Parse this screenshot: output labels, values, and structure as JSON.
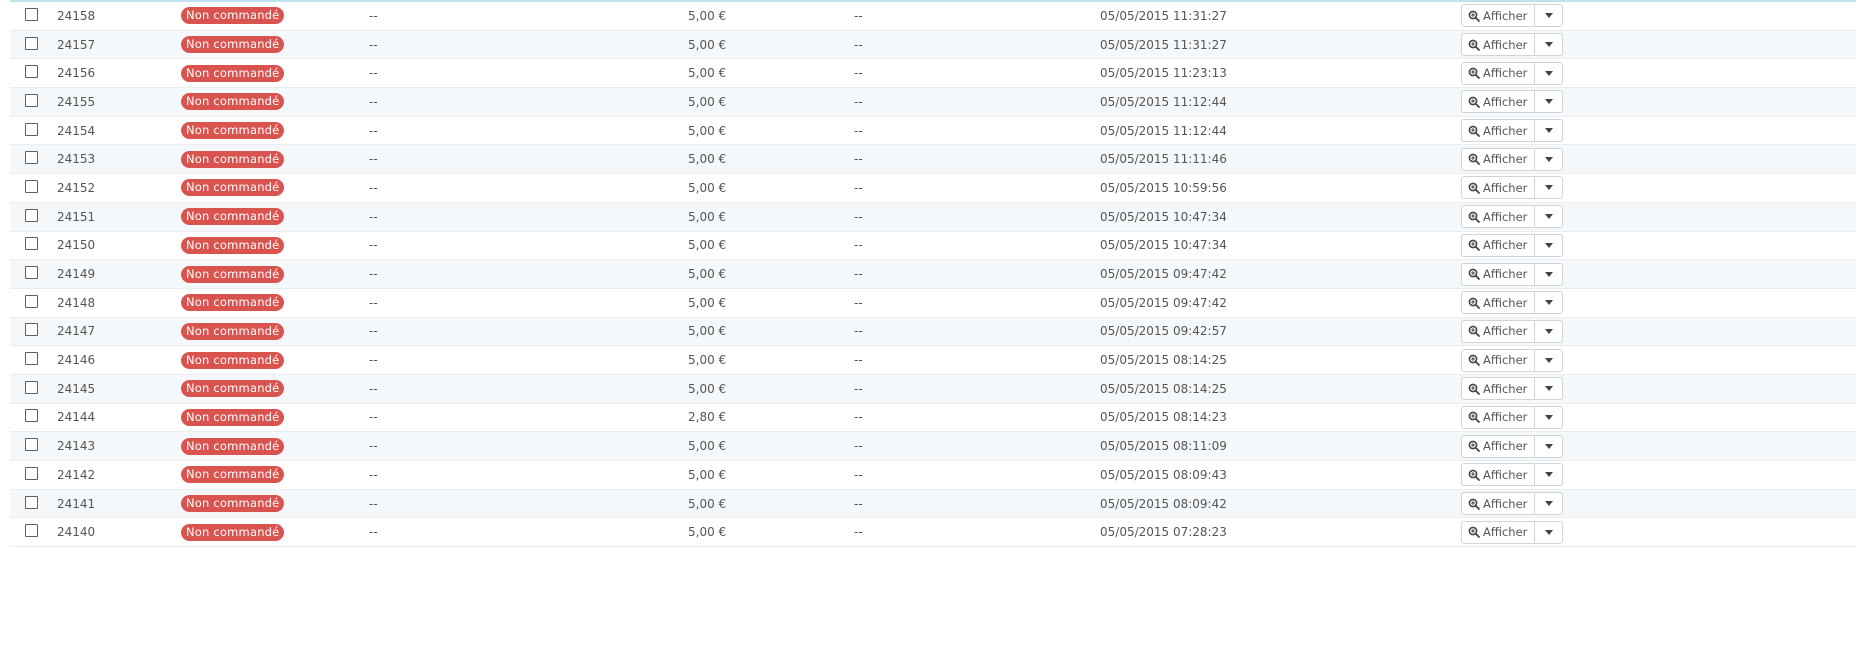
{
  "table": {
    "action_label": "Afficher",
    "rows": [
      {
        "id": "24158",
        "status": "Non commandé",
        "customer": "--",
        "total": "5,00 €",
        "payment": "--",
        "date": "05/05/2015 11:31:27"
      },
      {
        "id": "24157",
        "status": "Non commandé",
        "customer": "--",
        "total": "5,00 €",
        "payment": "--",
        "date": "05/05/2015 11:31:27"
      },
      {
        "id": "24156",
        "status": "Non commandé",
        "customer": "--",
        "total": "5,00 €",
        "payment": "--",
        "date": "05/05/2015 11:23:13"
      },
      {
        "id": "24155",
        "status": "Non commandé",
        "customer": "--",
        "total": "5,00 €",
        "payment": "--",
        "date": "05/05/2015 11:12:44"
      },
      {
        "id": "24154",
        "status": "Non commandé",
        "customer": "--",
        "total": "5,00 €",
        "payment": "--",
        "date": "05/05/2015 11:12:44"
      },
      {
        "id": "24153",
        "status": "Non commandé",
        "customer": "--",
        "total": "5,00 €",
        "payment": "--",
        "date": "05/05/2015 11:11:46"
      },
      {
        "id": "24152",
        "status": "Non commandé",
        "customer": "--",
        "total": "5,00 €",
        "payment": "--",
        "date": "05/05/2015 10:59:56"
      },
      {
        "id": "24151",
        "status": "Non commandé",
        "customer": "--",
        "total": "5,00 €",
        "payment": "--",
        "date": "05/05/2015 10:47:34"
      },
      {
        "id": "24150",
        "status": "Non commandé",
        "customer": "--",
        "total": "5,00 €",
        "payment": "--",
        "date": "05/05/2015 10:47:34"
      },
      {
        "id": "24149",
        "status": "Non commandé",
        "customer": "--",
        "total": "5,00 €",
        "payment": "--",
        "date": "05/05/2015 09:47:42"
      },
      {
        "id": "24148",
        "status": "Non commandé",
        "customer": "--",
        "total": "5,00 €",
        "payment": "--",
        "date": "05/05/2015 09:47:42"
      },
      {
        "id": "24147",
        "status": "Non commandé",
        "customer": "--",
        "total": "5,00 €",
        "payment": "--",
        "date": "05/05/2015 09:42:57"
      },
      {
        "id": "24146",
        "status": "Non commandé",
        "customer": "--",
        "total": "5,00 €",
        "payment": "--",
        "date": "05/05/2015 08:14:25"
      },
      {
        "id": "24145",
        "status": "Non commandé",
        "customer": "--",
        "total": "5,00 €",
        "payment": "--",
        "date": "05/05/2015 08:14:25"
      },
      {
        "id": "24144",
        "status": "Non commandé",
        "customer": "--",
        "total": "2,80 €",
        "payment": "--",
        "date": "05/05/2015 08:14:23"
      },
      {
        "id": "24143",
        "status": "Non commandé",
        "customer": "--",
        "total": "5,00 €",
        "payment": "--",
        "date": "05/05/2015 08:11:09"
      },
      {
        "id": "24142",
        "status": "Non commandé",
        "customer": "--",
        "total": "5,00 €",
        "payment": "--",
        "date": "05/05/2015 08:09:43"
      },
      {
        "id": "24141",
        "status": "Non commandé",
        "customer": "--",
        "total": "5,00 €",
        "payment": "--",
        "date": "05/05/2015 08:09:42"
      },
      {
        "id": "24140",
        "status": "Non commandé",
        "customer": "--",
        "total": "5,00 €",
        "payment": "--",
        "date": "05/05/2015 07:28:23"
      }
    ]
  },
  "colors": {
    "badge_red": "#d9534f",
    "row_alt": "#f5f8fa",
    "border": "#eaedef"
  },
  "icons": {
    "action": "zoom-in-icon",
    "dropdown": "caret-down-icon"
  }
}
